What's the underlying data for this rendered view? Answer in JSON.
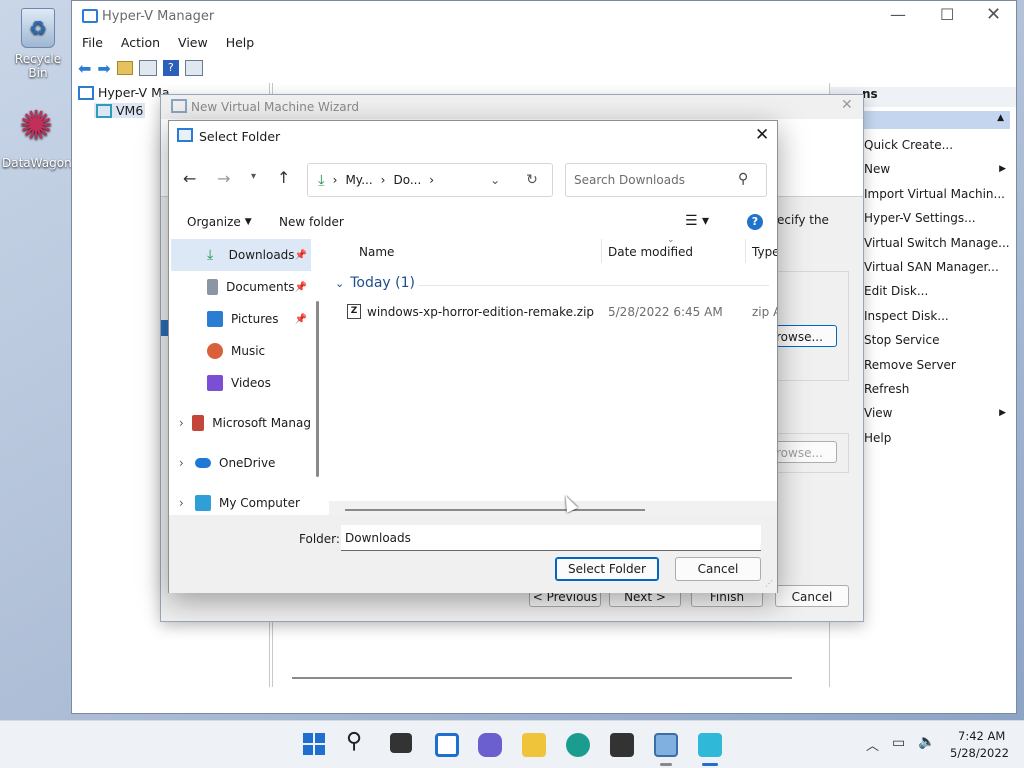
{
  "desktop": {
    "icons": [
      {
        "label": "Recycle Bin"
      },
      {
        "label": "DataWagon..."
      }
    ]
  },
  "hyperv": {
    "title": "Hyper-V Manager",
    "menu": [
      "File",
      "Action",
      "View",
      "Help"
    ],
    "tree": {
      "root": "Hyper-V Ma",
      "child": "VM6"
    },
    "actions": {
      "header": "ns",
      "items": [
        "Quick Create...",
        "New",
        "Import Virtual Machin...",
        "Hyper-V Settings...",
        "Virtual Switch Manage...",
        "Virtual SAN Manager...",
        "Edit Disk...",
        "Inspect Disk...",
        "Stop Service",
        "Remove Server",
        "Refresh",
        "View",
        "Help"
      ]
    }
  },
  "wizard": {
    "title": "New Virtual Machine Wizard",
    "specify_text": "ecify the",
    "browse1": "rowse...",
    "browse2": "rowse...",
    "buttons": {
      "previous": "< Previous",
      "next": "Next >",
      "finish": "Finish",
      "cancel": "Cancel"
    }
  },
  "dialog": {
    "title": "Select Folder",
    "breadcrumb": [
      "My...",
      "Do..."
    ],
    "search": {
      "placeholder": "Search Downloads"
    },
    "toolbar": {
      "organize": "Organize",
      "new_folder": "New folder"
    },
    "nav": [
      {
        "label": "Downloads",
        "pinned": true,
        "color": "#1f8f4e"
      },
      {
        "label": "Documents",
        "pinned": true,
        "color": "#8a96a6"
      },
      {
        "label": "Pictures",
        "pinned": true,
        "color": "#2b7cd3"
      },
      {
        "label": "Music",
        "pinned": false,
        "color": "#d9603b"
      },
      {
        "label": "Videos",
        "pinned": false,
        "color": "#7a4fd6"
      },
      {
        "label": "Microsoft Manag",
        "pinned": false,
        "color": "#c4463a"
      },
      {
        "label": "OneDrive",
        "pinned": false,
        "color": "#1e78d6"
      },
      {
        "label": "My Computer",
        "pinned": false,
        "color": "#2f9fd8"
      }
    ],
    "columns": {
      "name": "Name",
      "date": "Date modified",
      "type": "Type"
    },
    "group": "Today (1)",
    "files": [
      {
        "name": "windows-xp-horror-edition-remake.zip",
        "date": "5/28/2022 6:45 AM",
        "type": "zip A"
      }
    ],
    "folder_label": "Folder:",
    "folder_value": "Downloads",
    "buttons": {
      "select": "Select Folder",
      "cancel": "Cancel"
    }
  },
  "taskbar": {
    "time": "7:42 AM",
    "date": "5/28/2022"
  }
}
